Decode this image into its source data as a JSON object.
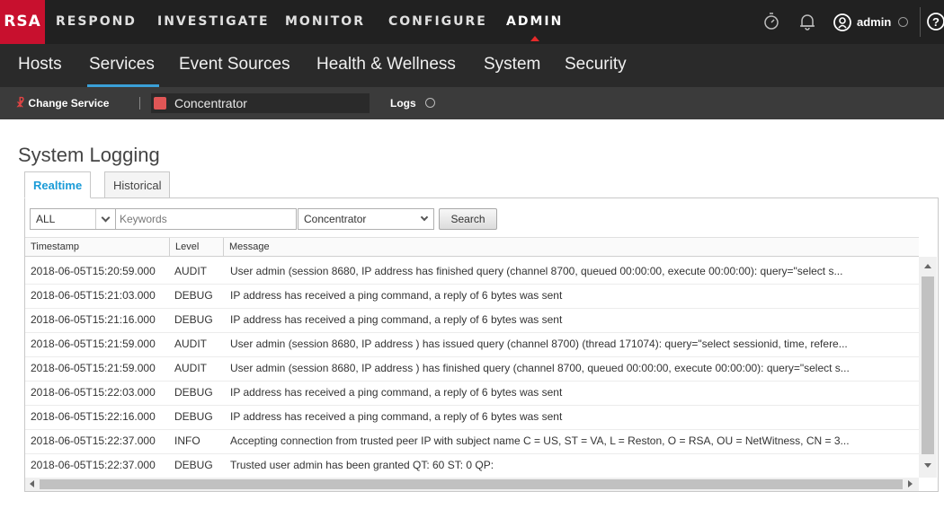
{
  "brand": {
    "logo": "RSA",
    "accent": "#c8102e"
  },
  "top_nav": {
    "items": [
      "RESPOND",
      "INVESTIGATE",
      "MONITOR",
      "CONFIGURE",
      "ADMIN"
    ],
    "active": "ADMIN",
    "icons": [
      "timer-icon",
      "bell-icon",
      "user-icon",
      "help-icon"
    ],
    "user": "admin",
    "help": "?"
  },
  "sub_nav": {
    "items": [
      "Hosts",
      "Services",
      "Event Sources",
      "Health & Wellness",
      "System",
      "Security"
    ],
    "active": "Services",
    "underline_color": "#3aa0d8"
  },
  "service_bar": {
    "change_service": "Change Service",
    "service": "Concentrator",
    "view": "Logs"
  },
  "page": {
    "title": "System Logging",
    "tabs": [
      "Realtime",
      "Historical"
    ],
    "active_tab": "Realtime"
  },
  "filters": {
    "level": "ALL",
    "keywords_placeholder": "Keywords",
    "service": "Concentrator",
    "search_label": "Search"
  },
  "table": {
    "columns": [
      "Timestamp",
      "Level",
      "Message"
    ],
    "rows": [
      {
        "timestamp": "2018-06-05T15:20:59.000",
        "level": "AUDIT",
        "message": "User admin (session 8680,  IP address          has finished query (channel 8700, queued 00:00:00, execute 00:00:00): query=\"select s..."
      },
      {
        "timestamp": "2018-06-05T15:21:03.000",
        "level": "DEBUG",
        "message": "IP address          has received a ping command, a reply of 6 bytes was sent"
      },
      {
        "timestamp": "2018-06-05T15:21:16.000",
        "level": "DEBUG",
        "message": "IP address          has received a ping command, a reply of 6 bytes was sent"
      },
      {
        "timestamp": "2018-06-05T15:21:59.000",
        "level": "AUDIT",
        "message": "User admin (session 8680,  IP address          ) has issued query (channel 8700) (thread 171074): query=\"select sessionid, time, refere..."
      },
      {
        "timestamp": "2018-06-05T15:21:59.000",
        "level": "AUDIT",
        "message": "User admin (session 8680,  IP address          ) has finished query (channel 8700, queued 00:00:00, execute 00:00:00): query=\"select s..."
      },
      {
        "timestamp": "2018-06-05T15:22:03.000",
        "level": "DEBUG",
        "message": "IP address          has received a ping command, a reply of 6 bytes was sent"
      },
      {
        "timestamp": "2018-06-05T15:22:16.000",
        "level": "DEBUG",
        "message": "IP address          has received a ping command, a reply of 6 bytes was sent"
      },
      {
        "timestamp": "2018-06-05T15:22:37.000",
        "level": "INFO",
        "message": "Accepting connection from trusted peer  IP          with subject name C = US, ST = VA, L = Reston, O = RSA, OU = NetWitness, CN = 3..."
      },
      {
        "timestamp": "2018-06-05T15:22:37.000",
        "level": "DEBUG",
        "message": "Trusted user admin has been granted QT: 60 ST: 0 QP:"
      }
    ]
  }
}
